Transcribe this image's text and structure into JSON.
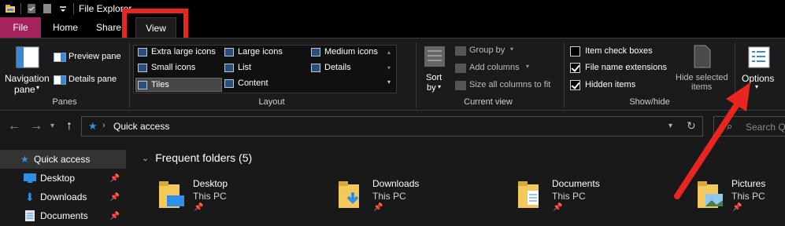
{
  "window": {
    "title": "File Explorer"
  },
  "tabs": {
    "file": "File",
    "home": "Home",
    "share": "Share",
    "view": "View"
  },
  "ribbon": {
    "panes": {
      "navigation_pane_line1": "Navigation",
      "navigation_pane_line2": "pane",
      "preview_pane": "Preview pane",
      "details_pane": "Details pane",
      "label": "Panes"
    },
    "layout": {
      "items": [
        "Extra large icons",
        "Large icons",
        "Medium icons",
        "Small icons",
        "List",
        "Details",
        "Tiles",
        "Content"
      ],
      "selected": "Tiles",
      "label": "Layout"
    },
    "current_view": {
      "sort_line1": "Sort",
      "sort_line2": "by",
      "group_by": "Group by",
      "add_columns": "Add columns",
      "size_all_columns": "Size all columns to fit",
      "label": "Current view"
    },
    "show_hide": {
      "item_check_boxes": {
        "label": "Item check boxes",
        "checked": false
      },
      "file_name_extensions": {
        "label": "File name extensions",
        "checked": true
      },
      "hidden_items": {
        "label": "Hidden items",
        "checked": true
      },
      "hide_selected_line1": "Hide selected",
      "hide_selected_line2": "items",
      "label": "Show/hide"
    },
    "options": {
      "label": "Options"
    }
  },
  "address": {
    "path": "Quick access",
    "search_placeholder": "Search Qu"
  },
  "nav_pane": {
    "items": [
      {
        "label": "Quick access",
        "active": true
      },
      {
        "label": "Desktop"
      },
      {
        "label": "Downloads"
      },
      {
        "label": "Documents"
      }
    ]
  },
  "content": {
    "section_title": "Frequent folders (5)",
    "folders": [
      {
        "name": "Desktop",
        "location": "This PC"
      },
      {
        "name": "Downloads",
        "location": "This PC"
      },
      {
        "name": "Documents",
        "location": "This PC"
      },
      {
        "name": "Pictures",
        "location": "This PC"
      }
    ]
  },
  "colors": {
    "file_tab": "#a4225e",
    "annotation_red": "#e8251f",
    "folder": "#f3c95c",
    "accent_blue": "#2f8fe8"
  }
}
